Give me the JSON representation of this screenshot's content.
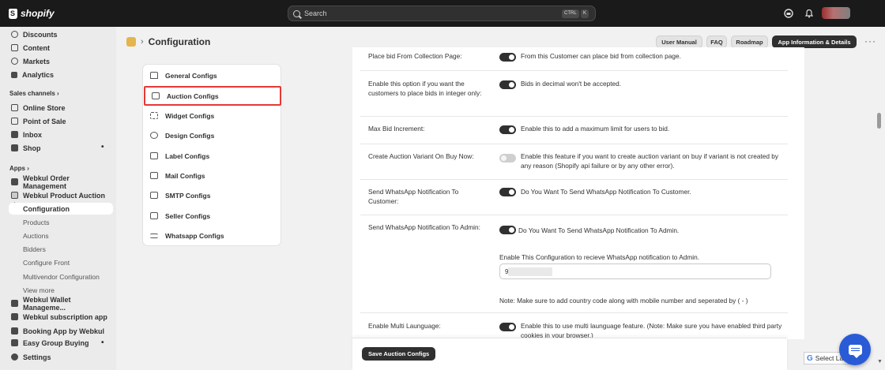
{
  "topbar": {
    "brand": "shopify",
    "search_placeholder": "Search",
    "kbd_ctrl": "CTRL",
    "kbd_k": "K"
  },
  "sidebar": {
    "top_items": [
      {
        "label": "Discounts",
        "icon": "discount-icon"
      },
      {
        "label": "Content",
        "icon": "content-icon"
      },
      {
        "label": "Markets",
        "icon": "globe-icon"
      },
      {
        "label": "Analytics",
        "icon": "analytics-icon"
      }
    ],
    "sales_channels_heading": "Sales channels",
    "sales_channels": [
      {
        "label": "Online Store",
        "icon": "store-icon"
      },
      {
        "label": "Point of Sale",
        "icon": "pos-icon"
      },
      {
        "label": "Inbox",
        "icon": "inbox-icon"
      },
      {
        "label": "Shop",
        "icon": "shop-icon"
      }
    ],
    "apps_heading": "Apps",
    "apps": [
      {
        "label": "Webkul Order Management"
      },
      {
        "label": "Webkul Product Auction"
      }
    ],
    "active_item": "Configuration",
    "sub_items": [
      "Products",
      "Auctions",
      "Bidders",
      "Configure Front",
      "Multivendor Configuration",
      "View more"
    ],
    "more_apps": [
      {
        "label": "Webkul Wallet Manageme..."
      },
      {
        "label": "Webkul subscription app"
      },
      {
        "label": "Booking App by Webkul"
      },
      {
        "label": "Easy Group Buying"
      }
    ],
    "settings_label": "Settings"
  },
  "header": {
    "title": "Configuration",
    "buttons": [
      "User Manual",
      "FAQ",
      "Roadmap",
      "App Information & Details"
    ]
  },
  "config_menu": [
    {
      "label": "General Configs",
      "icon": "home-icon"
    },
    {
      "label": "Auction Configs",
      "icon": "gavel-icon",
      "selected": true
    },
    {
      "label": "Widget Configs",
      "icon": "widget-icon"
    },
    {
      "label": "Design Configs",
      "icon": "eye-icon"
    },
    {
      "label": "Label Configs",
      "icon": "label-icon"
    },
    {
      "label": "Mail Configs",
      "icon": "mail-icon"
    },
    {
      "label": "SMTP Configs",
      "icon": "chat-icon"
    },
    {
      "label": "Seller Configs",
      "icon": "seller-icon"
    },
    {
      "label": "Whatsapp Configs",
      "icon": "sliders-icon"
    }
  ],
  "settings_rows": [
    {
      "label": "Place bid From Collection Page:",
      "toggle_on": true,
      "desc": "From this Customer can place bid from collection page."
    },
    {
      "label": "Enable this option if you want the customers to place bids in integer only:",
      "toggle_on": true,
      "desc": "Bids in decimal won't be accepted."
    },
    {
      "label": "Max Bid Increment:",
      "toggle_on": true,
      "desc": "Enable this to add a maximum limit for users to bid."
    },
    {
      "label": "Create Auction Variant On Buy Now:",
      "toggle_on": false,
      "desc": "Enable this feature if you want to create auction variant on buy if variant is not created by any reason (Shopify api failure or by any other error)."
    },
    {
      "label": "Send WhatsApp Notification To Customer:",
      "toggle_on": true,
      "desc": "Do You Want To Send WhatsApp Notification To Customer."
    },
    {
      "label": "Send WhatsApp Notification To Admin:",
      "toggle_on": true,
      "desc": "Do You Want To Send WhatsApp Notification To Admin."
    },
    {
      "label": "Enable Multi Launguage:",
      "toggle_on": true,
      "desc": "Enable this to use multi launguage feature. (Note: Make sure you have enabled third party cookies in your browser.)"
    }
  ],
  "whatsapp_admin": {
    "input_label": "Enable This Configuration to recieve WhatsApp notification to Admin.",
    "input_value": "9",
    "note": "Note:  Make sure to add country code along with mobile number and seperated by ( - )"
  },
  "footer": {
    "save_label": "Save Auction Configs"
  },
  "translate": {
    "label": "Select La"
  }
}
